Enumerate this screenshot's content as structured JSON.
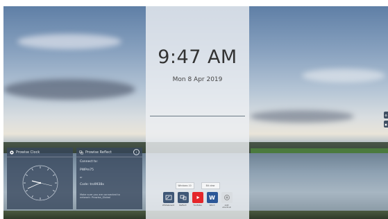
{
  "clock": {
    "time": "9:47 AM",
    "date": "Mon 8 Apr 2019"
  },
  "sources": [
    {
      "label": "Windows 10"
    },
    {
      "label": "Bit view"
    }
  ],
  "dock": [
    {
      "label": "Whiteboard",
      "icon": "whiteboard-icon",
      "color": "#3f5776"
    },
    {
      "label": "Reflect",
      "icon": "reflect-icon",
      "color": "#3f5776"
    },
    {
      "label": "YouTube",
      "icon": "youtube-icon",
      "color": "#e4262a"
    },
    {
      "label": "Word",
      "icon": "word-icon",
      "color": "#2b5797"
    },
    {
      "label": "Add shortcut",
      "icon": "plus-icon",
      "color": "#d9dde1"
    }
  ],
  "widgets": {
    "clock": {
      "title": "Prowise Clock"
    },
    "reflect": {
      "title": "Prowise Reflect",
      "connect_to": "Connect to:",
      "device": "PWPm75",
      "or": "or",
      "code": "Code: tro9938x",
      "hint": "Make sure you are connected to network: Prowise_Global"
    }
  },
  "colors": {
    "panel": "#ebeef2",
    "widget_bg": "#37465c"
  }
}
